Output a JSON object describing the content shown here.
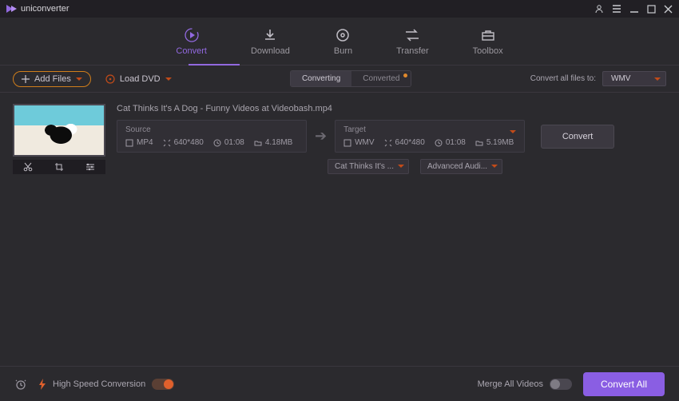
{
  "app": {
    "title": "uniconverter"
  },
  "nav": {
    "convert": "Convert",
    "download": "Download",
    "burn": "Burn",
    "transfer": "Transfer",
    "toolbox": "Toolbox"
  },
  "toolbar": {
    "add_files": "Add Files",
    "load_dvd": "Load DVD",
    "seg_converting": "Converting",
    "seg_converted": "Converted",
    "convert_all_label": "Convert all files to:",
    "convert_all_format": "WMV"
  },
  "file": {
    "name": "Cat Thinks It's A Dog - Funny Videos at Videobash.mp4",
    "source": {
      "label": "Source",
      "format": "MP4",
      "resolution": "640*480",
      "duration": "01:08",
      "size": "4.18MB"
    },
    "target": {
      "label": "Target",
      "format": "WMV",
      "resolution": "640*480",
      "duration": "01:08",
      "size": "5.19MB"
    },
    "dropdown_subtitle": "Cat Thinks It's ...",
    "dropdown_audio": "Advanced Audi...",
    "convert_btn": "Convert"
  },
  "bottom": {
    "high_speed": "High Speed Conversion",
    "merge": "Merge All Videos",
    "convert_all": "Convert All"
  }
}
